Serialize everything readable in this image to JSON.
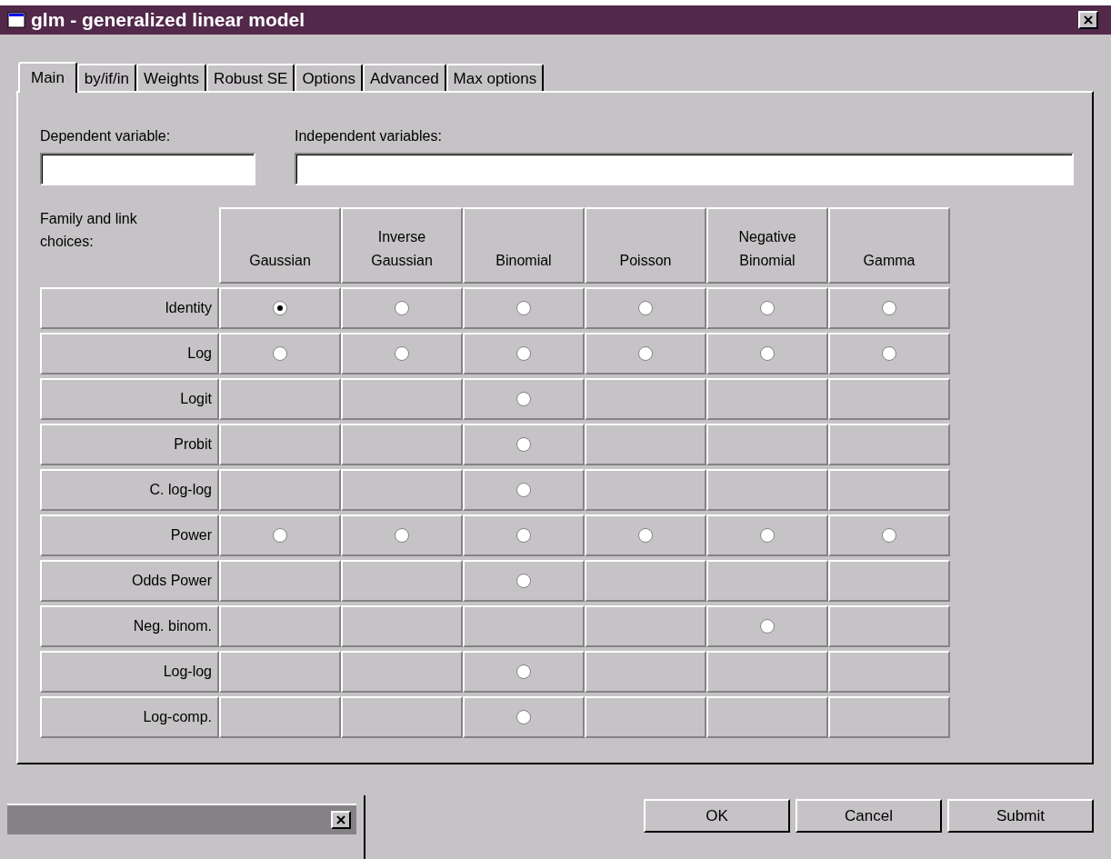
{
  "window": {
    "title": "glm - generalized linear model"
  },
  "tabs": [
    {
      "label": "Main",
      "selected": true
    },
    {
      "label": "by/if/in",
      "selected": false
    },
    {
      "label": "Weights",
      "selected": false
    },
    {
      "label": "Robust SE",
      "selected": false
    },
    {
      "label": "Options",
      "selected": false
    },
    {
      "label": "Advanced",
      "selected": false
    },
    {
      "label": "Max options",
      "selected": false
    }
  ],
  "fields": [
    {
      "label": "Dependent variable:"
    },
    {
      "label": "Independent variables:"
    }
  ],
  "grid": {
    "corner_label": "Family and link choices:",
    "columns": [
      "Gaussian",
      "Inverse Gaussian",
      "Binomial",
      "Poisson",
      "Negative Binomial",
      "Gamma"
    ],
    "rows": [
      {
        "label": "Identity",
        "cells": [
          {
            "kind": "radio",
            "selected": true
          },
          {
            "kind": "radio",
            "selected": false
          },
          {
            "kind": "radio",
            "selected": false
          },
          {
            "kind": "radio",
            "selected": false
          },
          {
            "kind": "radio",
            "selected": false
          },
          {
            "kind": "radio",
            "selected": false
          }
        ]
      },
      {
        "label": "Log",
        "cells": [
          {
            "kind": "radio",
            "selected": false
          },
          {
            "kind": "radio",
            "selected": false
          },
          {
            "kind": "radio",
            "selected": false
          },
          {
            "kind": "radio",
            "selected": false
          },
          {
            "kind": "radio",
            "selected": false
          },
          {
            "kind": "radio",
            "selected": false
          }
        ]
      },
      {
        "label": "Logit",
        "cells": [
          {
            "kind": "empty"
          },
          {
            "kind": "empty"
          },
          {
            "kind": "radio",
            "selected": false
          },
          {
            "kind": "empty"
          },
          {
            "kind": "empty"
          },
          {
            "kind": "empty"
          }
        ]
      },
      {
        "label": "Probit",
        "cells": [
          {
            "kind": "empty"
          },
          {
            "kind": "empty"
          },
          {
            "kind": "radio",
            "selected": false
          },
          {
            "kind": "empty"
          },
          {
            "kind": "empty"
          },
          {
            "kind": "empty"
          }
        ]
      },
      {
        "label": "C. log-log",
        "cells": [
          {
            "kind": "empty"
          },
          {
            "kind": "empty"
          },
          {
            "kind": "radio",
            "selected": false
          },
          {
            "kind": "empty"
          },
          {
            "kind": "empty"
          },
          {
            "kind": "empty"
          }
        ]
      },
      {
        "label": "Power",
        "cells": [
          {
            "kind": "radio",
            "selected": false
          },
          {
            "kind": "radio",
            "selected": false
          },
          {
            "kind": "radio",
            "selected": false
          },
          {
            "kind": "radio",
            "selected": false
          },
          {
            "kind": "radio",
            "selected": false
          },
          {
            "kind": "radio",
            "selected": false
          }
        ]
      },
      {
        "label": "Odds Power",
        "cells": [
          {
            "kind": "empty"
          },
          {
            "kind": "empty"
          },
          {
            "kind": "radio",
            "selected": false
          },
          {
            "kind": "empty"
          },
          {
            "kind": "empty"
          },
          {
            "kind": "empty"
          }
        ]
      },
      {
        "label": "Neg. binom.",
        "cells": [
          {
            "kind": "empty"
          },
          {
            "kind": "empty"
          },
          {
            "kind": "empty"
          },
          {
            "kind": "empty"
          },
          {
            "kind": "radio",
            "selected": false
          },
          {
            "kind": "empty"
          }
        ]
      },
      {
        "label": "Log-log",
        "cells": [
          {
            "kind": "empty"
          },
          {
            "kind": "empty"
          },
          {
            "kind": "radio",
            "selected": false
          },
          {
            "kind": "empty"
          },
          {
            "kind": "empty"
          },
          {
            "kind": "empty"
          }
        ]
      },
      {
        "label": "Log-comp.",
        "cells": [
          {
            "kind": "empty"
          },
          {
            "kind": "empty"
          },
          {
            "kind": "radio",
            "selected": false
          },
          {
            "kind": "empty"
          },
          {
            "kind": "empty"
          },
          {
            "kind": "empty"
          }
        ]
      }
    ]
  },
  "buttons": [
    "OK",
    "Cancel",
    "Submit"
  ]
}
